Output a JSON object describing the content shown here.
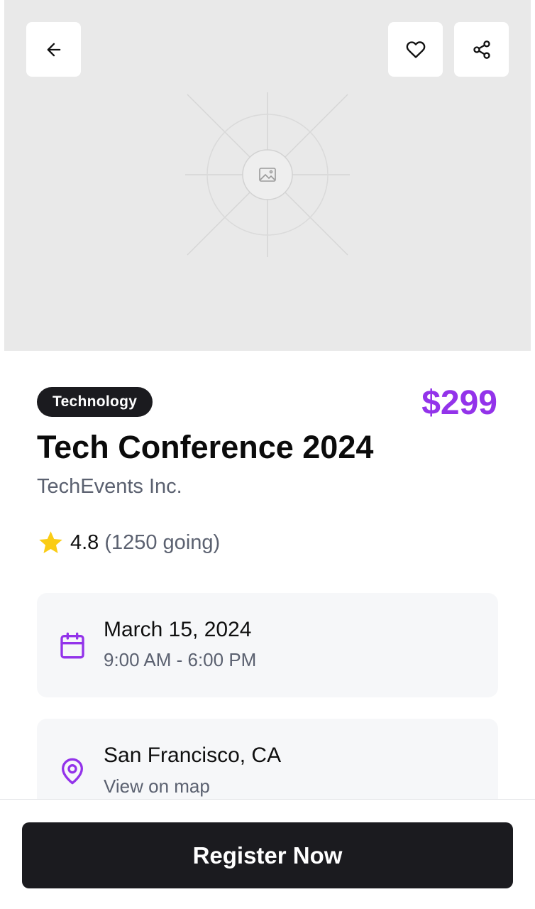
{
  "hero": {
    "image_icon": "image-placeholder-icon",
    "back_icon": "arrow-left-icon",
    "favorite_icon": "heart-icon",
    "share_icon": "share-icon"
  },
  "event": {
    "category": "Technology",
    "price": "$299",
    "title": "Tech Conference 2024",
    "organizer": "TechEvents Inc.",
    "rating": "4.8",
    "going": "(1250 going)",
    "date": "March 15, 2024",
    "time": "9:00 AM - 6:00 PM",
    "location": "San Francisco, CA",
    "map_link": "View on map"
  },
  "actions": {
    "register_label": "Register Now"
  },
  "colors": {
    "accent": "#9333ea",
    "star": "#facc15",
    "dark": "#1b1b1f",
    "muted_text": "#5b6170",
    "card_bg": "#f6f7f9"
  }
}
